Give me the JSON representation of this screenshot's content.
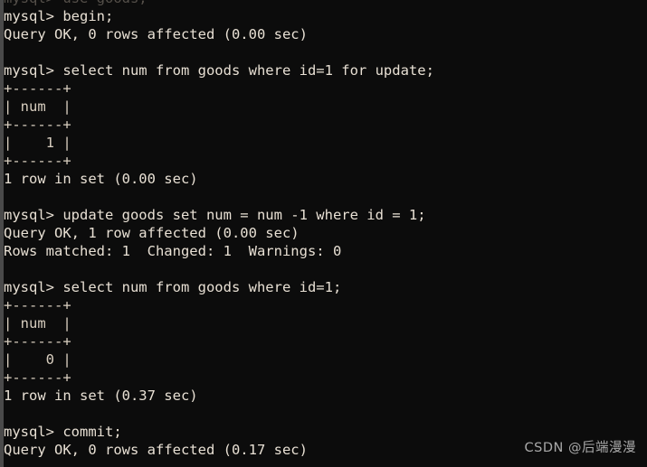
{
  "terminal": {
    "app_name": "mysql-client-terminal",
    "background_color": "#0c0c0c",
    "text_color": "#e8e0d4",
    "gutter_color": "#3c3c3c",
    "prompt": "mysql>",
    "lines": [
      {
        "kind": "ghost",
        "text": "mysql> use goods;"
      },
      {
        "kind": "prompt",
        "text": "mysql> begin;"
      },
      {
        "kind": "result",
        "text": "Query OK, 0 rows affected (0.00 sec)"
      },
      {
        "kind": "blank",
        "text": " "
      },
      {
        "kind": "prompt",
        "text": "mysql> select num from goods where id=1 for update;"
      },
      {
        "kind": "rule",
        "text": "+------+"
      },
      {
        "kind": "rule",
        "text": "| num  |"
      },
      {
        "kind": "rule",
        "text": "+------+"
      },
      {
        "kind": "rule",
        "text": "|    1 |"
      },
      {
        "kind": "rule",
        "text": "+------+"
      },
      {
        "kind": "result",
        "text": "1 row in set (0.00 sec)"
      },
      {
        "kind": "blank",
        "text": " "
      },
      {
        "kind": "prompt",
        "text": "mysql> update goods set num = num -1 where id = 1;"
      },
      {
        "kind": "result",
        "text": "Query OK, 1 row affected (0.00 sec)"
      },
      {
        "kind": "result",
        "text": "Rows matched: 1  Changed: 1  Warnings: 0"
      },
      {
        "kind": "blank",
        "text": " "
      },
      {
        "kind": "prompt",
        "text": "mysql> select num from goods where id=1;"
      },
      {
        "kind": "rule",
        "text": "+------+"
      },
      {
        "kind": "rule",
        "text": "| num  |"
      },
      {
        "kind": "rule",
        "text": "+------+"
      },
      {
        "kind": "rule",
        "text": "|    0 |"
      },
      {
        "kind": "rule",
        "text": "+------+"
      },
      {
        "kind": "result",
        "text": "1 row in set (0.37 sec)"
      },
      {
        "kind": "blank",
        "text": " "
      },
      {
        "kind": "prompt",
        "text": "mysql> commit;"
      },
      {
        "kind": "result",
        "text": "Query OK, 0 rows affected (0.17 sec)"
      }
    ]
  },
  "result_tables": [
    {
      "name": "select-for-update-result",
      "columns": [
        "num"
      ],
      "rows": [
        [
          "1"
        ]
      ],
      "status": "1 row in set (0.00 sec)"
    },
    {
      "name": "select-after-update-result",
      "columns": [
        "num"
      ],
      "rows": [
        [
          "0"
        ]
      ],
      "status": "1 row in set (0.37 sec)"
    }
  ],
  "watermark": {
    "text": "CSDN @后端漫漫",
    "color": "#a9a9a9"
  }
}
